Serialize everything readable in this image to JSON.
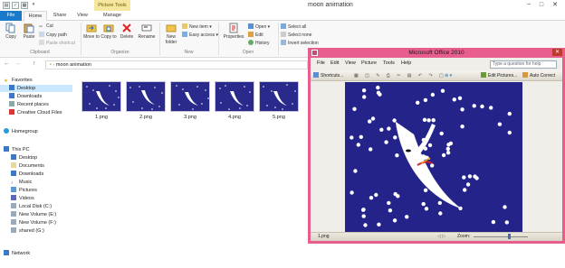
{
  "window": {
    "title": "moon animation",
    "context_tab": "Picture Tools",
    "minimize": "−",
    "maximize": "□",
    "close": "✕"
  },
  "ribbon_tabs": {
    "file": "File",
    "home": "Home",
    "share": "Share",
    "view": "View",
    "manage": "Manage"
  },
  "ribbon": {
    "copy": "Copy",
    "paste": "Paste",
    "cut": "Cut",
    "copy_path": "Copy path",
    "paste_shortcut": "Paste shortcut",
    "move_to": "Move to",
    "copy_to": "Copy to",
    "delete": "Delete",
    "rename": "Rename",
    "new_folder": "New folder",
    "new_item": "New item ▾",
    "easy_access": "Easy access ▾",
    "properties": "Properties",
    "open": "Open ▾",
    "edit": "Edit",
    "history": "History",
    "select_all": "Select all",
    "select_none": "Select none",
    "invert_selection": "Invert selection",
    "groups": {
      "clipboard": "Clipboard",
      "organize": "Organize",
      "new": "New",
      "open": "Open",
      "select": "Select"
    }
  },
  "address": {
    "path": "moon animation",
    "back": "←",
    "forward": "→",
    "up": "↑"
  },
  "nav": {
    "favorites": "Favorites",
    "desktop": "Desktop",
    "downloads": "Downloads",
    "recent_places": "Recent places",
    "creative_cloud": "Creative Cloud Files",
    "homegroup": "Homegroup",
    "this_pc": "This PC",
    "pc_desktop": "Desktop",
    "documents": "Documents",
    "pc_downloads": "Downloads",
    "music": "Music",
    "pictures": "Pictures",
    "videos": "Videos",
    "local_disk": "Local Disk (C:)",
    "vol_e": "New Volume (E:)",
    "vol_f": "New Volume (F:)",
    "shared": "shared (G:)",
    "network": "Network"
  },
  "files": [
    "1.png",
    "2.png",
    "3.png",
    "4.png",
    "5.png"
  ],
  "picture_manager": {
    "title": "Microsoft Office 2010",
    "menus": {
      "file": "File",
      "edit": "Edit",
      "view": "View",
      "picture": "Picture",
      "tools": "Tools",
      "help": "Help"
    },
    "ask_placeholder": "Type a question for help",
    "toolbar": {
      "shortcuts": "Shortcuts...",
      "edit_pictures": "Edit Pictures...",
      "auto_correct": "Auto Correct"
    },
    "status": {
      "filename": "1.png",
      "zoom_label": "Zoom:"
    }
  },
  "colors": {
    "accent": "#1979ca",
    "picmgr_border": "#e75d8e",
    "sky": "#2a2a8c",
    "context_tab": "#f5e79e"
  }
}
